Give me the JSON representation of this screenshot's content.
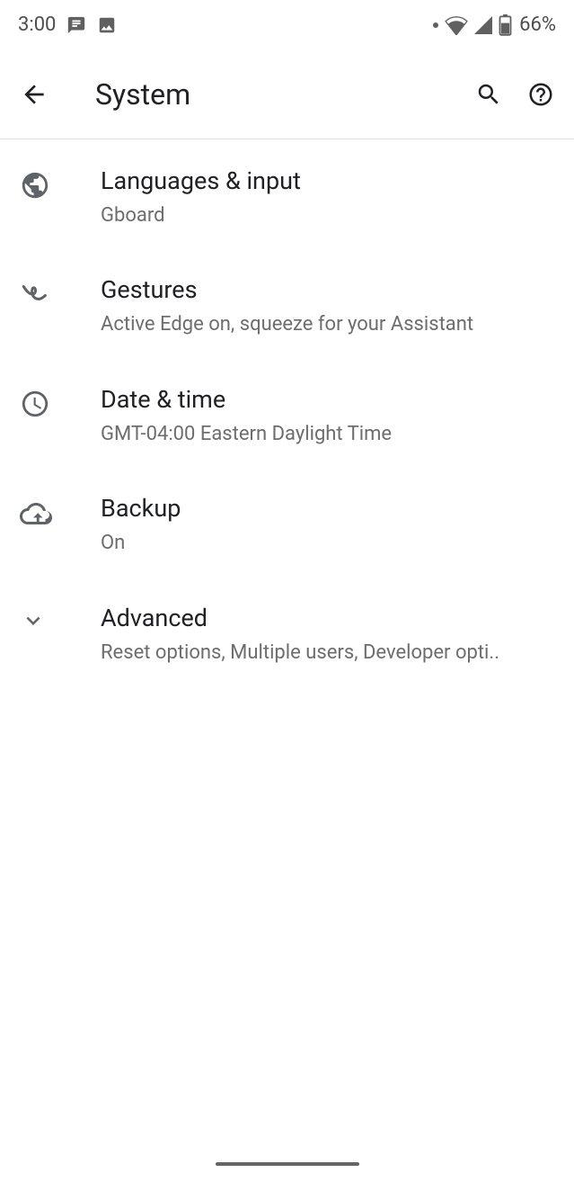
{
  "status": {
    "time": "3:00",
    "battery": "66%"
  },
  "header": {
    "title": "System"
  },
  "items": [
    {
      "icon": "globe-icon",
      "title": "Languages & input",
      "subtitle": "Gboard"
    },
    {
      "icon": "gesture-icon",
      "title": "Gestures",
      "subtitle": "Active Edge on, squeeze for your Assistant"
    },
    {
      "icon": "clock-icon",
      "title": "Date & time",
      "subtitle": "GMT-04:00 Eastern Daylight Time"
    },
    {
      "icon": "cloud-upload-icon",
      "title": "Backup",
      "subtitle": "On"
    },
    {
      "icon": "chevron-down-icon",
      "title": "Advanced",
      "subtitle": "Reset options, Multiple users, Developer opti.."
    }
  ]
}
